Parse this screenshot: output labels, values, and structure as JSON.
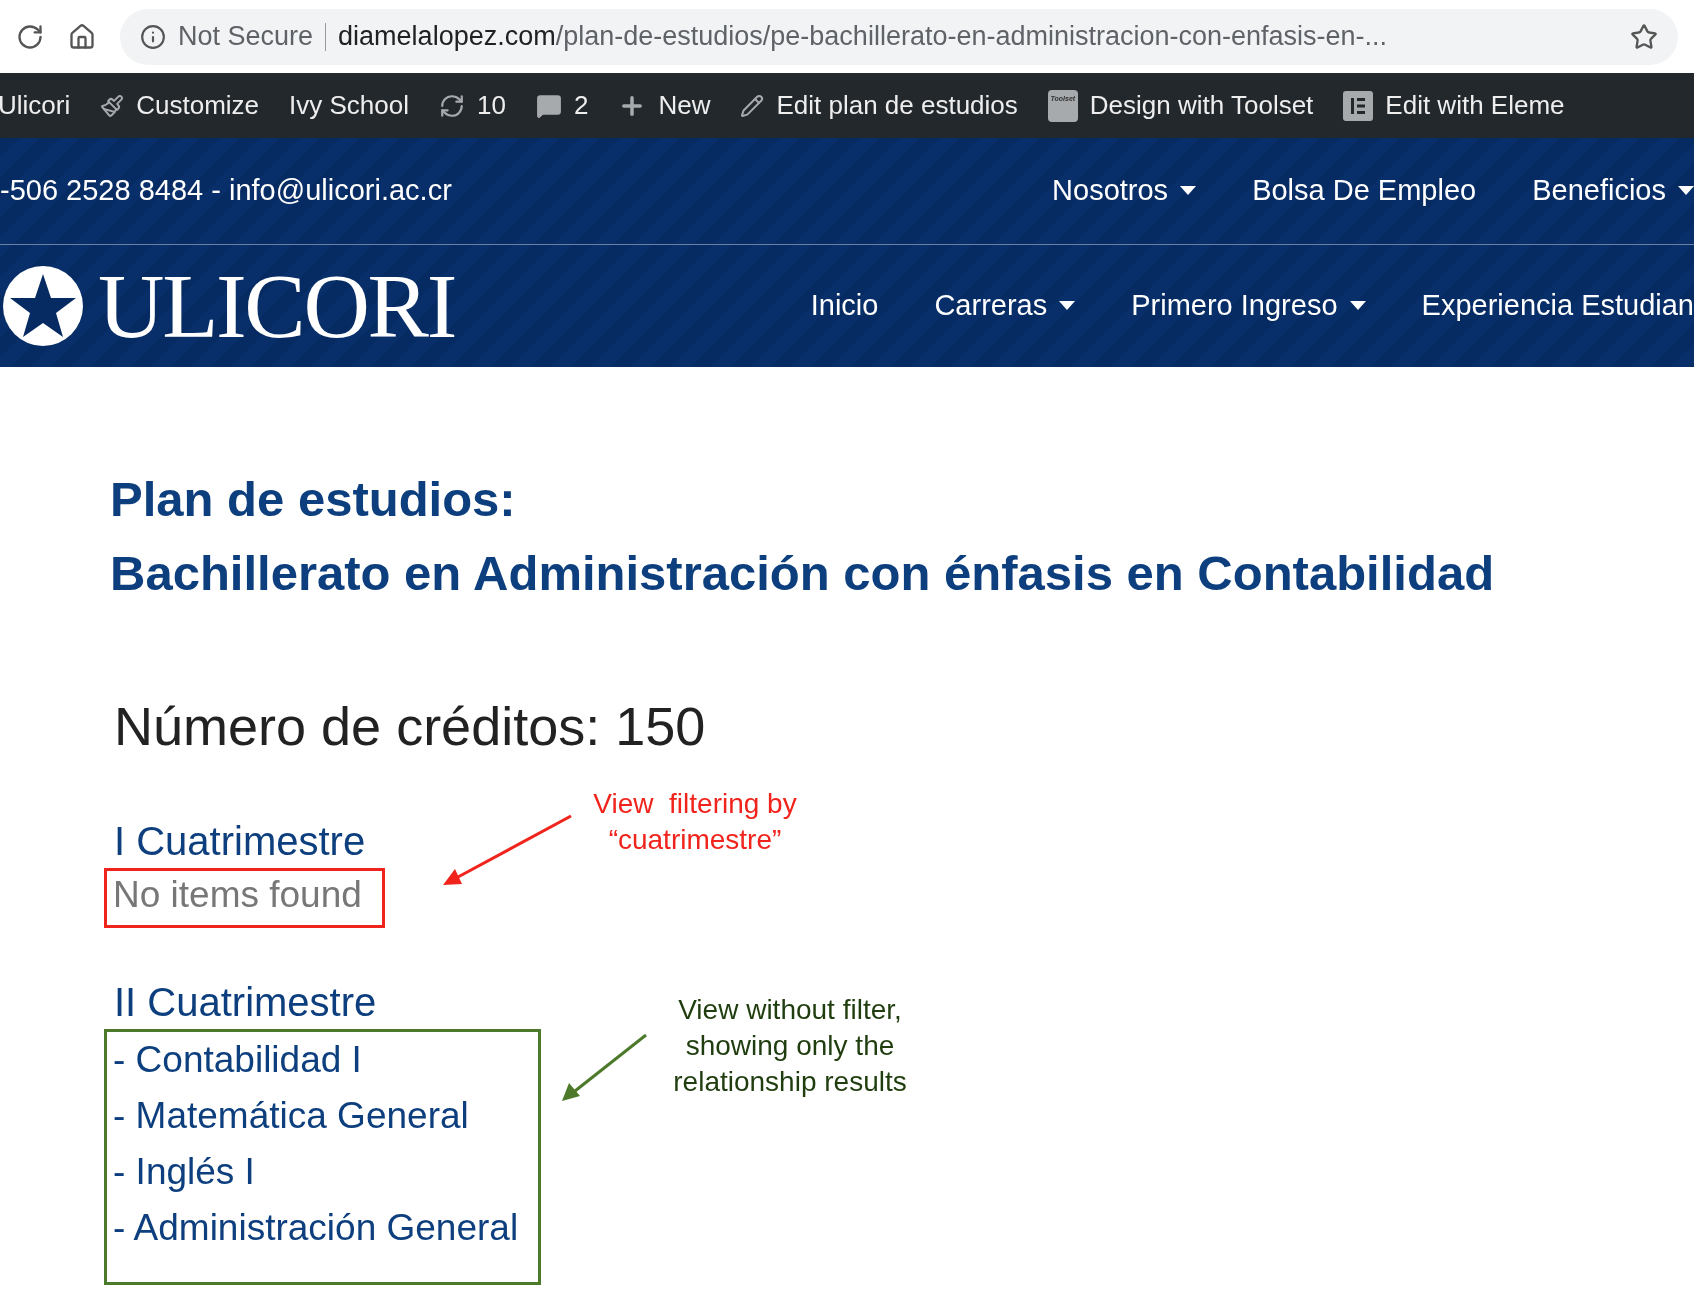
{
  "browser": {
    "security_label": "Not Secure",
    "url_host": "diamelalopez.com",
    "url_path": "/plan-de-estudios/pe-bachillerato-en-administracion-con-enfasis-en-..."
  },
  "admin_bar": [
    {
      "kind": "site",
      "label": "Ulicori"
    },
    {
      "kind": "customize",
      "label": "Customize"
    },
    {
      "kind": "theme",
      "label": "Ivy School"
    },
    {
      "kind": "updates",
      "label": "10"
    },
    {
      "kind": "comments",
      "label": "2"
    },
    {
      "kind": "new",
      "label": "New"
    },
    {
      "kind": "edit",
      "label": "Edit plan de estudios"
    },
    {
      "kind": "toolset",
      "label": "Design with Toolset",
      "icon_text": "Toolset"
    },
    {
      "kind": "elementor",
      "label": "Edit with Eleme"
    }
  ],
  "top_header": {
    "contact": "-506 2528 8484 - info@ulicori.ac.cr",
    "menu": [
      {
        "label": "Nosotros",
        "dropdown": true
      },
      {
        "label": "Bolsa De Empleo",
        "dropdown": false
      },
      {
        "label": "Beneficios",
        "dropdown": true
      }
    ]
  },
  "nav": {
    "logo_text": "ULICORI",
    "items": [
      {
        "label": "Inicio",
        "dropdown": false
      },
      {
        "label": "Carreras",
        "dropdown": true
      },
      {
        "label": "Primero Ingreso",
        "dropdown": true
      },
      {
        "label": "Experiencia Estudian",
        "dropdown": false
      }
    ]
  },
  "page": {
    "title_line_1": "Plan de estudios:",
    "title_line_2": "Bachillerato en Administración con énfasis en Contabilidad",
    "credits": "Número de créditos: 150",
    "sections": [
      {
        "title": "I Cuatrimestre",
        "empty_text": "No items found"
      },
      {
        "title": "II Cuatrimestre",
        "items": [
          "- Contabilidad I",
          "- Matemática General",
          "- Inglés I",
          "- Administración General"
        ]
      }
    ]
  },
  "annotations": [
    {
      "text": "View  filtering by\n“cuatrimestre”",
      "color": "#f0241c"
    },
    {
      "text": "View without filter,\nshowing only the\nrelationship results",
      "color": "#4d7a2a"
    }
  ]
}
